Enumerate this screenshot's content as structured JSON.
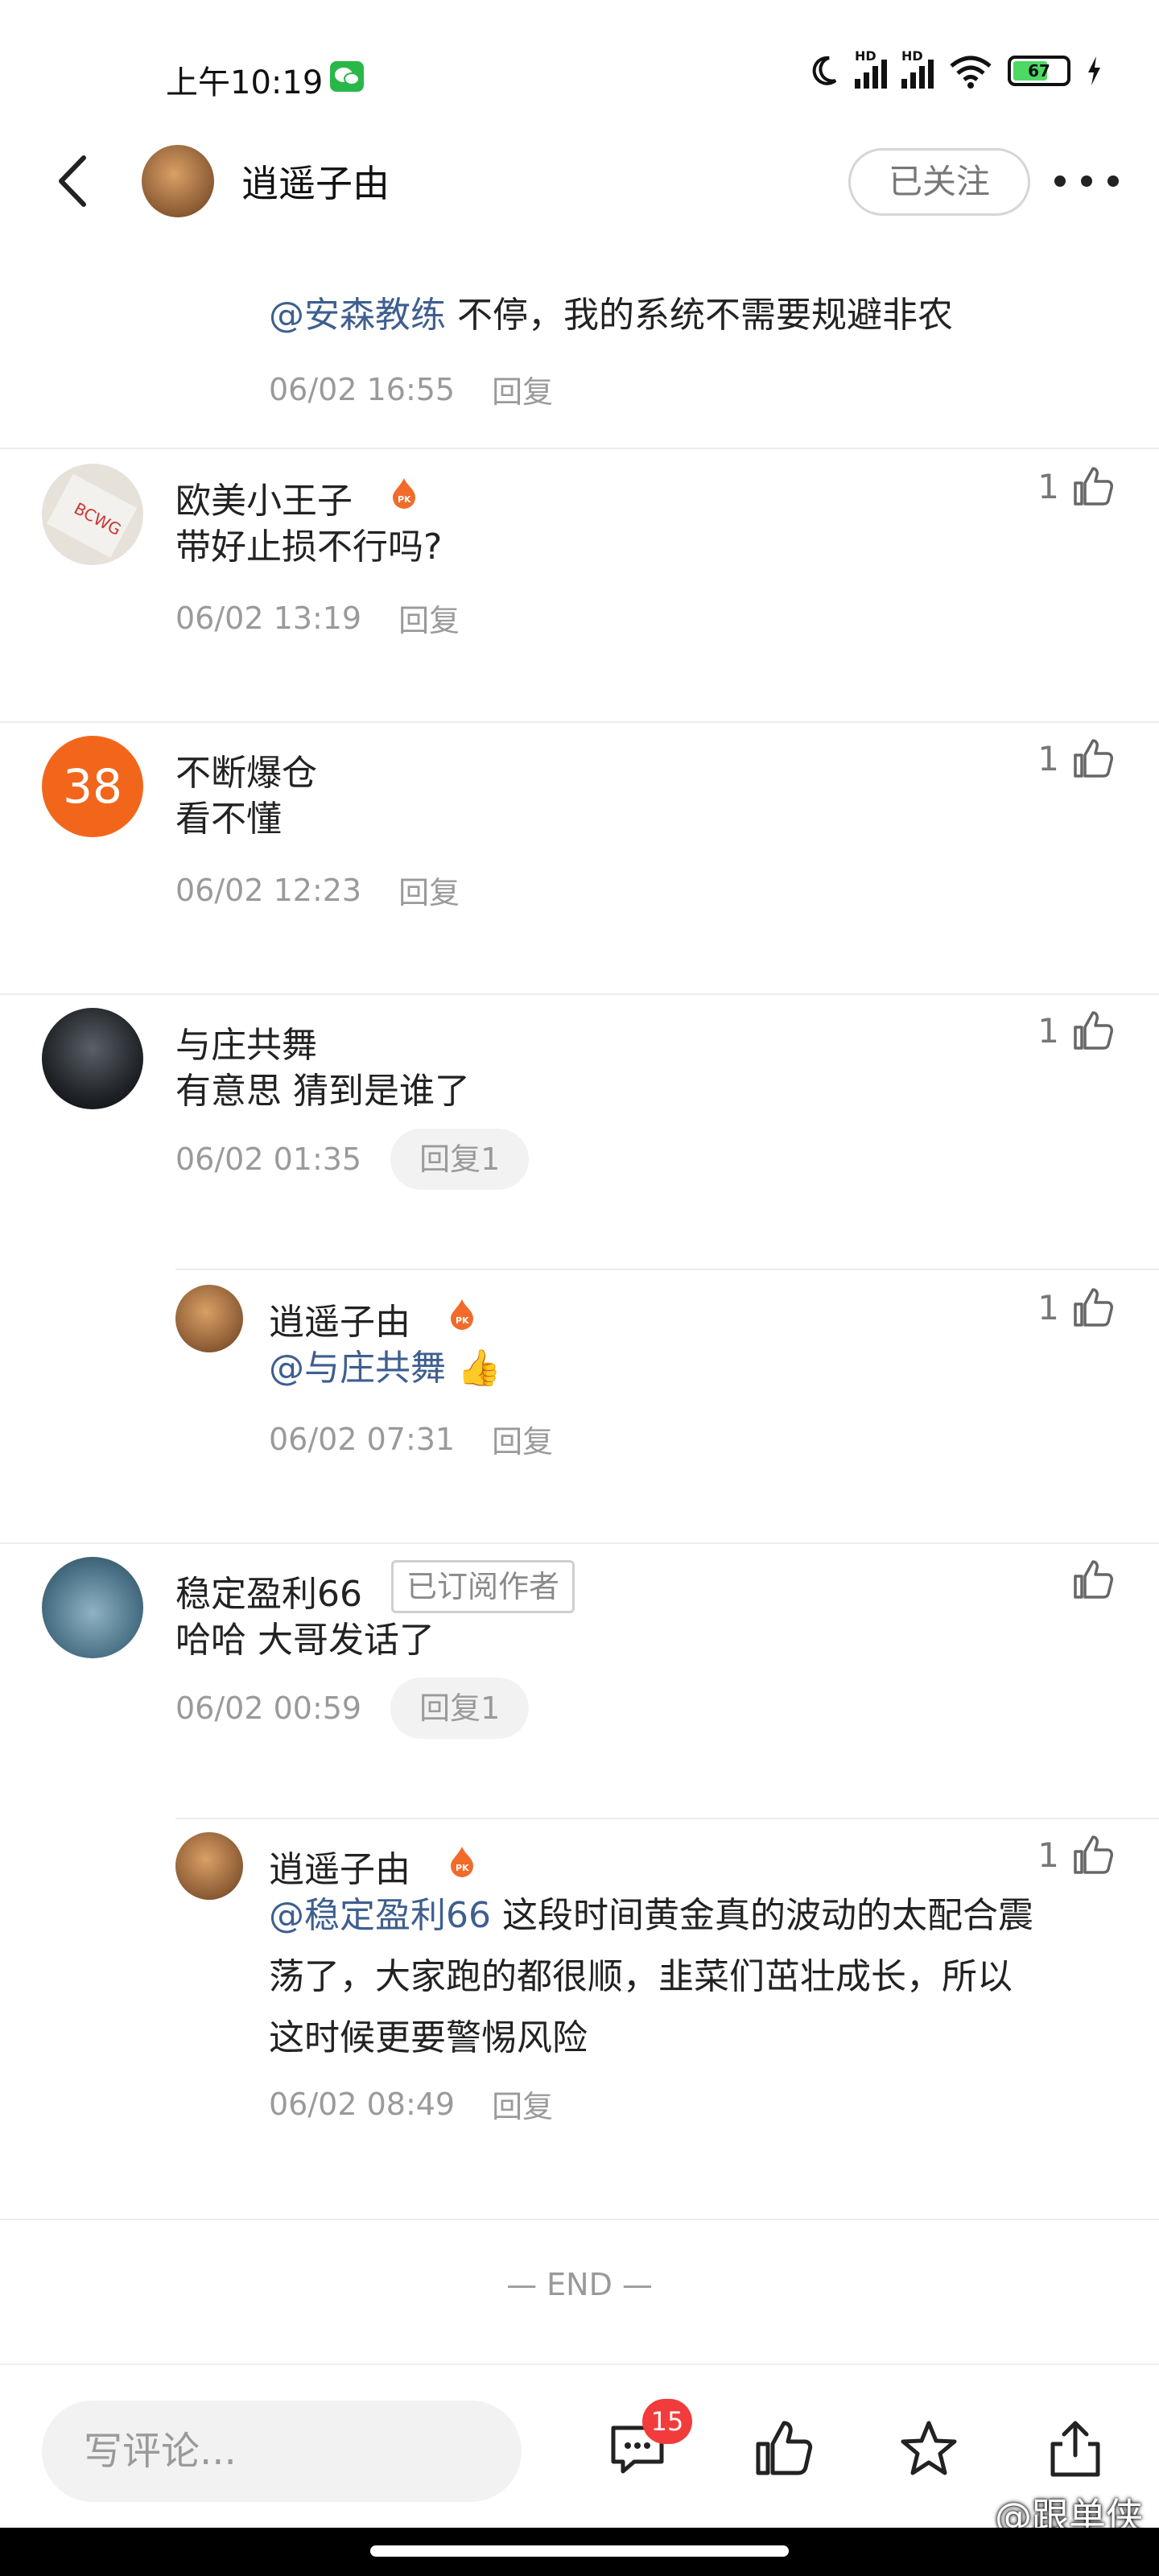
{
  "status": {
    "time": "上午10:19",
    "battery": "67",
    "hd1": "HD",
    "hd2": "HD"
  },
  "header": {
    "title": "逍遥子由",
    "follow_label": "已关注"
  },
  "comments": [
    {
      "text_mention": "@安森教练",
      "text": " 不停，我的系统不需要规避非农",
      "time": "06/02 16:55",
      "reply": "回复"
    },
    {
      "name": "欧美小王子",
      "likes": "1",
      "text": "带好止损不行吗?",
      "time": "06/02 13:19",
      "reply": "回复"
    },
    {
      "name": "不断爆仓",
      "avatar_text": "38",
      "likes": "1",
      "text": "看不懂",
      "time": "06/02 12:23",
      "reply": "回复"
    },
    {
      "name": "与庄共舞",
      "likes": "1",
      "text": "有意思 猜到是谁了",
      "time": "06/02 01:35",
      "reply": "回复1"
    },
    {
      "name": "逍遥子由",
      "likes": "1",
      "text_mention": "@与庄共舞",
      "text": " 👍",
      "time": "06/02 07:31",
      "reply": "回复"
    },
    {
      "name": "稳定盈利66",
      "badge": "已订阅作者",
      "likes": "",
      "text": "哈哈 大哥发话了",
      "time": "06/02 00:59",
      "reply": "回复1"
    },
    {
      "name": "逍遥子由",
      "likes": "1",
      "text_mention": "@稳定盈利66",
      "text_line1": " 这段时间黄金真的波动的太配合震",
      "text_line2": "荡了，大家跑的都很顺，韭菜们茁壮成长，所以",
      "text_line3": "这时候更要警惕风险",
      "time": "06/02 08:49",
      "reply": "回复"
    }
  ],
  "end_label": "— END —",
  "bottom": {
    "placeholder": "写评论...",
    "comment_count": "15"
  },
  "watermark": "@跟单侠",
  "colors": {
    "mention": "#3e5f8f",
    "badge": "#f23b3b",
    "flame": "#f26b2a",
    "avatar38": "#f2661c"
  }
}
